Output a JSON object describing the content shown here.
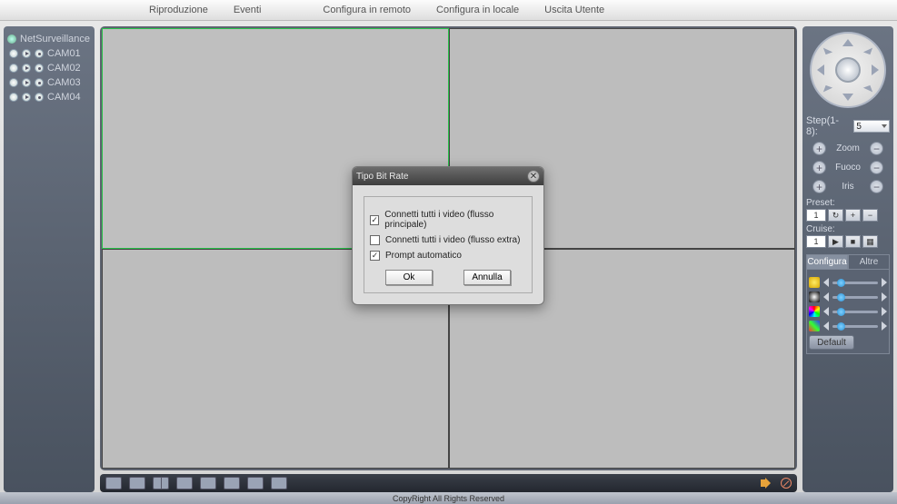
{
  "menu": {
    "items": [
      "Riproduzione",
      "Eventi",
      "Configura in remoto",
      "Configura in locale",
      "Uscita Utente"
    ]
  },
  "sidebar": {
    "root": "NetSurveillance",
    "cameras": [
      "CAM01",
      "CAM02",
      "CAM03",
      "CAM04"
    ]
  },
  "ptz": {
    "step_label": "Step(1-8):",
    "step_value": "5",
    "zoom": "Zoom",
    "focus": "Fuoco",
    "iris": "Iris",
    "preset_label": "Preset:",
    "preset_value": "1",
    "cruise_label": "Cruise:",
    "cruise_value": "1"
  },
  "tabs": {
    "configure": "Configura",
    "other": "Altre",
    "default_btn": "Default"
  },
  "modal": {
    "title": "Tipo Bit Rate",
    "opt_main": "Connetti tutti i video (flusso principale)",
    "opt_extra": "Connetti tutti i video (flusso extra)",
    "opt_prompt": "Prompt automatico",
    "ok": "Ok",
    "cancel": "Annulla",
    "checked_main": true,
    "checked_extra": false,
    "checked_prompt": true
  },
  "footer": "CopyRight  All Rights Reserved"
}
